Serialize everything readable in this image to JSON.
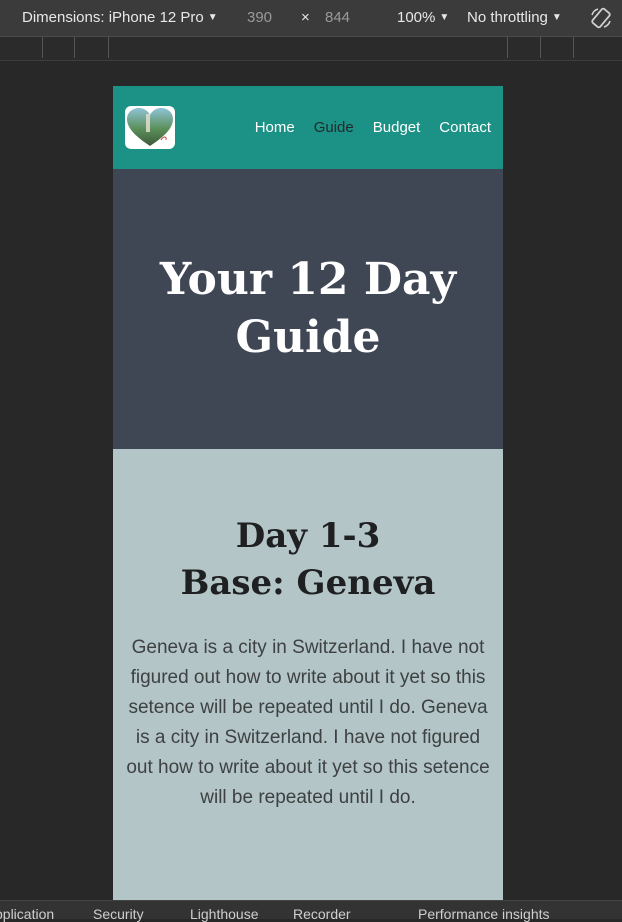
{
  "devtools": {
    "dimensions_label": "Dimensions: iPhone 12 Pro",
    "width": "390",
    "times": "×",
    "height": "844",
    "zoom": "100%",
    "throttling": "No throttling",
    "icons": {
      "rotate": "rotate-icon",
      "caret": "caret-down-icon"
    }
  },
  "site": {
    "nav": [
      {
        "label": "Home",
        "active": false
      },
      {
        "label": "Guide",
        "active": true
      },
      {
        "label": "Budget",
        "active": false
      },
      {
        "label": "Contact",
        "active": false
      }
    ],
    "logo": "heart-photo-logo",
    "colors": {
      "header": "#1c9185",
      "hero": "#3f4654",
      "content": "#b3c5c7"
    }
  },
  "hero": {
    "title": "Your 12 Day Guide"
  },
  "section": {
    "title_line1": "Day 1-3",
    "title_line2": "Base: Geneva",
    "body": "Geneva is a city in Switzerland. I have not figured out how to write about it yet so this setence will be repeated until I do. Geneva is a city in Switzerland. I have not figured out how to write about it yet so this setence will be repeated until I do."
  },
  "bottom_tabs": [
    "pplication",
    "Security",
    "Lighthouse",
    "Recorder",
    "Performance insights"
  ]
}
